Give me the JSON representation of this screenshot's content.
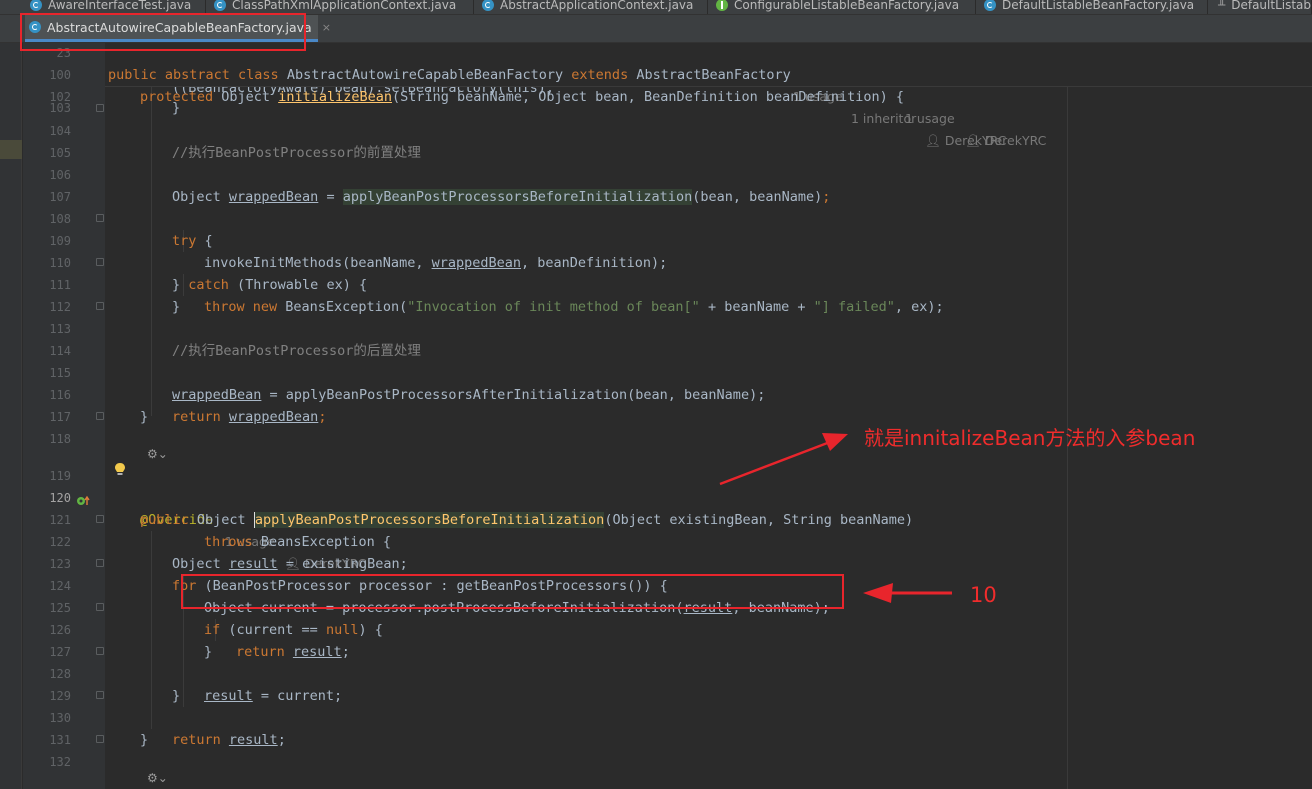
{
  "tabs_top": [
    {
      "label": "AwareInterfaceTest.java",
      "icon": "class-icon"
    },
    {
      "label": "ClassPathXmlApplicationContext.java",
      "icon": "class-icon"
    },
    {
      "label": "AbstractApplicationContext.java",
      "icon": "class-icon"
    },
    {
      "label": "ConfigurableListableBeanFactory.java",
      "icon": "interface-icon"
    },
    {
      "label": "DefaultListableBeanFactory.java",
      "icon": "class-icon"
    },
    {
      "label": "DefaultListab",
      "icon": "structure-icon"
    }
  ],
  "active_tab": {
    "label": "AbstractAutowireCapableBeanFactory.java",
    "close": "×"
  },
  "sticky": {
    "line1_num": "23",
    "line1_kw1": "public abstract class ",
    "line1_name": "AbstractAutowireCapableBeanFactory ",
    "line1_kw2": "extends ",
    "line1_parent": "AbstractBeanFactory",
    "line1_hint_usage": "1 usage",
    "line1_hint_inheritor": "1 inheritor",
    "line1_hint_author": "DerekYRC",
    "line2_num": "100",
    "line2_kw": "protected ",
    "line2_pre": "Object ",
    "line2_fn": "initializeBean",
    "line2_post": "(String beanName, Object bean, BeanDefinition beanDefinition) {",
    "line2_hint_usage": "1 usage",
    "line2_hint_author": "DerekYRC"
  },
  "lines": {
    "l102": {
      "num": "102",
      "text": "((BeanFactoryAware) bean).setBeanFactory(this);"
    },
    "l103": {
      "num": "103",
      "text": "}"
    },
    "l104": {
      "num": "104"
    },
    "l105": {
      "num": "105",
      "text": "//执行BeanPostProcessor的前置处理"
    },
    "l106": {
      "num": "106",
      "a": "Object ",
      "b": "wrappedBean",
      "c": " = ",
      "d": "applyBeanPostProcessorsBeforeInitialization",
      "e": "(bean, beanName)",
      "f": ";"
    },
    "l107": {
      "num": "107"
    },
    "l108": {
      "num": "108",
      "a": "try",
      "b": " {"
    },
    "l109": {
      "num": "109",
      "a": "invokeInitMethods(beanName, ",
      "b": "wrappedBean",
      "c": ", beanDefinition);"
    },
    "l110": {
      "num": "110",
      "a": "} ",
      "b": "catch",
      "c": " (Throwable ex) {"
    },
    "l111": {
      "num": "111",
      "a": "throw new ",
      "b": "BeansException(",
      "c": "\"Invocation of init method of bean[\"",
      "d": " + beanName + ",
      "e": "\"] failed\"",
      "f": ", ex);"
    },
    "l112": {
      "num": "112",
      "text": "}"
    },
    "l113": {
      "num": "113"
    },
    "l114": {
      "num": "114",
      "text": "//执行BeanPostProcessor的后置处理"
    },
    "l115": {
      "num": "115",
      "a": "wrappedBean",
      "b": " = applyBeanPostProcessorsAfterInitialization(bean, beanName);"
    },
    "l116": {
      "num": "116",
      "a": "return ",
      "b": "wrappedBean",
      "c": ";"
    },
    "l117": {
      "num": "117",
      "text": "}"
    },
    "l118": {
      "num": "118"
    },
    "l119": {
      "num": "119",
      "ann": "@Override",
      "hint_usage": "1 usage",
      "hint_author": "DerekYRC"
    },
    "l120": {
      "num": "120",
      "a": "public ",
      "b": "Object ",
      "c": "applyBeanPostProcessorsBeforeInitialization",
      "d": "(Object existingBean, String beanName)"
    },
    "l121": {
      "num": "121",
      "a": "throws ",
      "b": "BeansException {"
    },
    "l122": {
      "num": "122",
      "a": "Object ",
      "b": "result",
      "c": " = existingBean;"
    },
    "l123": {
      "num": "123",
      "a": "for ",
      "b": "(BeanPostProcessor processor : getBeanPostProcessors()) {"
    },
    "l124": {
      "num": "124",
      "a": "Object current = processor.postProcessBeforeInitialization(",
      "b": "result",
      "c": ", beanName);"
    },
    "l125": {
      "num": "125",
      "a": "if ",
      "b": "(current == ",
      "c": "null",
      "d": ") {"
    },
    "l126": {
      "num": "126",
      "a": "return ",
      "b": "result",
      "c": ";"
    },
    "l127": {
      "num": "127",
      "text": "}"
    },
    "l128": {
      "num": "128",
      "a": "result",
      "b": " = current;"
    },
    "l129": {
      "num": "129",
      "text": "}"
    },
    "l130": {
      "num": "130",
      "a": "return ",
      "b": "result",
      "c": ";"
    },
    "l131": {
      "num": "131",
      "text": "}"
    },
    "l132": {
      "num": "132"
    }
  },
  "annotations": {
    "note1": "就是innitalizeBean方法的入参bean",
    "note2": "10",
    "color": "#f02c2c"
  },
  "colors": {
    "keyword": "#cc7832",
    "string": "#6a8759",
    "comment": "#808080",
    "function": "#ffc66d",
    "annotation": "#bbb529",
    "background": "#2b2b2b"
  }
}
